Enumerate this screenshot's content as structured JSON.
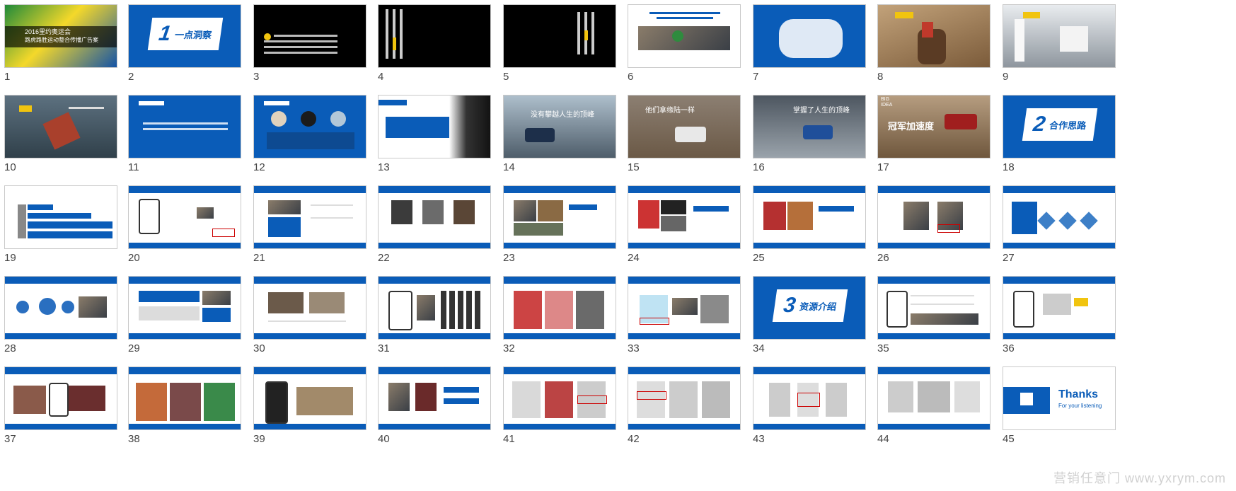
{
  "slides": [
    {
      "n": "1"
    },
    {
      "n": "2"
    },
    {
      "n": "3"
    },
    {
      "n": "4"
    },
    {
      "n": "5"
    },
    {
      "n": "6"
    },
    {
      "n": "7"
    },
    {
      "n": "8"
    },
    {
      "n": "9"
    },
    {
      "n": "10"
    },
    {
      "n": "11"
    },
    {
      "n": "12"
    },
    {
      "n": "13"
    },
    {
      "n": "14"
    },
    {
      "n": "15"
    },
    {
      "n": "16"
    },
    {
      "n": "17"
    },
    {
      "n": "18"
    },
    {
      "n": "19"
    },
    {
      "n": "20"
    },
    {
      "n": "21"
    },
    {
      "n": "22"
    },
    {
      "n": "23"
    },
    {
      "n": "24"
    },
    {
      "n": "25"
    },
    {
      "n": "26"
    },
    {
      "n": "27"
    },
    {
      "n": "28"
    },
    {
      "n": "29"
    },
    {
      "n": "30"
    },
    {
      "n": "31"
    },
    {
      "n": "32"
    },
    {
      "n": "33"
    },
    {
      "n": "34"
    },
    {
      "n": "35"
    },
    {
      "n": "36"
    },
    {
      "n": "37"
    },
    {
      "n": "38"
    },
    {
      "n": "39"
    },
    {
      "n": "40"
    },
    {
      "n": "41"
    },
    {
      "n": "42"
    },
    {
      "n": "43"
    },
    {
      "n": "44"
    },
    {
      "n": "45"
    }
  ],
  "slide_text": {
    "s1_title": "2016里约奥运会",
    "s1_sub": "路虎路胜运动整合传播广告案",
    "s2_num": "1",
    "s2_label": "一点洞察",
    "s14_text": "没有攀越人生的顶峰",
    "s15_text": "他们拿缘陆一样",
    "s16_text": "掌握了人生的顶峰",
    "s17_tag": "BIG IDEA",
    "s17_title": "冠军加速度",
    "s18_num": "2",
    "s18_label": "合作思路",
    "s34_num": "3",
    "s34_label": "资源介绍",
    "s45_thanks": "Thanks",
    "s45_sub": "For your listening"
  },
  "watermark": "营销任意门 www.yxrym.com",
  "colors": {
    "accent": "#0a5cb8",
    "highlight": "#f1c40f"
  }
}
